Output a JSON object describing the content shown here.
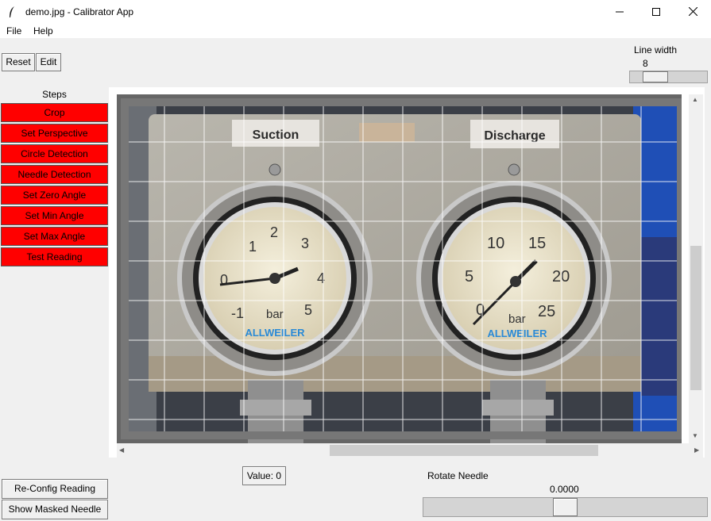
{
  "window": {
    "title": "demo.jpg - Calibrator App",
    "minimize_glyph": "—",
    "maximize_glyph": "☐",
    "close_glyph": "✕"
  },
  "menu": {
    "items": [
      "File",
      "Help"
    ]
  },
  "toolbar": {
    "reset_label": "Reset",
    "edit_label": "Edit"
  },
  "line_width": {
    "label": "Line width",
    "value": "8",
    "slider_fraction": 0.25
  },
  "steps": {
    "title": "Steps",
    "items": [
      "Crop",
      "Set Perspective",
      "Circle Detection",
      "Needle Detection",
      "Set Zero Angle",
      "Set Min Angle",
      "Set Max Angle",
      "Test Reading"
    ],
    "color": "#ff0000"
  },
  "image": {
    "left_gauge": {
      "label": "Suction",
      "ticks": [
        "-1",
        "0",
        "1",
        "2",
        "3",
        "4",
        "5"
      ],
      "unit": "bar",
      "brand": "ALLWEILER"
    },
    "right_gauge": {
      "label": "Discharge",
      "ticks": [
        "0",
        "5",
        "10",
        "15",
        "20",
        "25"
      ],
      "unit": "bar",
      "brand": "ALLWEILER"
    }
  },
  "bottom": {
    "reconfig_label": "Re-Config Reading",
    "show_mask_label": "Show Masked Needle",
    "value_label": "Value: 0",
    "rotate_label": "Rotate Needle",
    "rotate_value": "0.0000",
    "rotate_fraction": 0.5
  },
  "scroll_arrows": {
    "up": "▲",
    "down": "▼",
    "left": "◀",
    "right": "▶"
  }
}
